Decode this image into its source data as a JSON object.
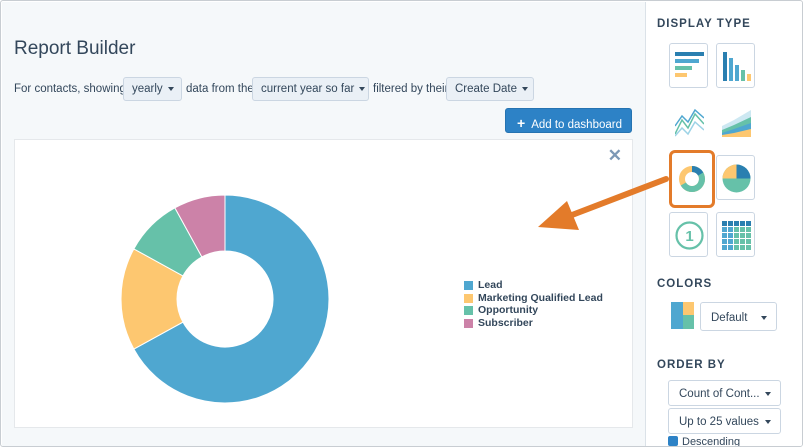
{
  "title": "Report Builder",
  "filters": {
    "prefix": "For contacts, showing",
    "frequency": "yearly",
    "mid": "data from the",
    "range": "current year so far",
    "suffix": "filtered by their",
    "date_field": "Create Date"
  },
  "add_button": "Add to dashboard",
  "close_glyph": "✕",
  "chart_data": {
    "type": "pie",
    "donut": true,
    "categories": [
      "Lead",
      "Marketing Qualified Lead",
      "Opportunity",
      "Subscriber"
    ],
    "values": [
      67,
      16,
      9,
      8
    ],
    "colors": [
      "#4fa7d0",
      "#fdc770",
      "#66c1a9",
      "#cc82a8"
    ],
    "legend_position": "right"
  },
  "sidebar": {
    "display_type_heading": "DISPLAY TYPE",
    "display_types": [
      {
        "icon": "horizontal-bar-chart-icon"
      },
      {
        "icon": "vertical-bar-chart-icon"
      },
      {
        "icon": "line-chart-icon"
      },
      {
        "icon": "area-chart-icon"
      },
      {
        "icon": "donut-chart-icon",
        "selected": true
      },
      {
        "icon": "pie-chart-icon"
      },
      {
        "icon": "number-icon",
        "glyph": "1"
      },
      {
        "icon": "table-icon"
      }
    ],
    "colors_heading": "COLORS",
    "colors_value": "Default",
    "order_heading": "ORDER BY",
    "order_value": "Count of Cont...",
    "limit_value": "Up to 25 values",
    "descending_label": "Descending"
  }
}
